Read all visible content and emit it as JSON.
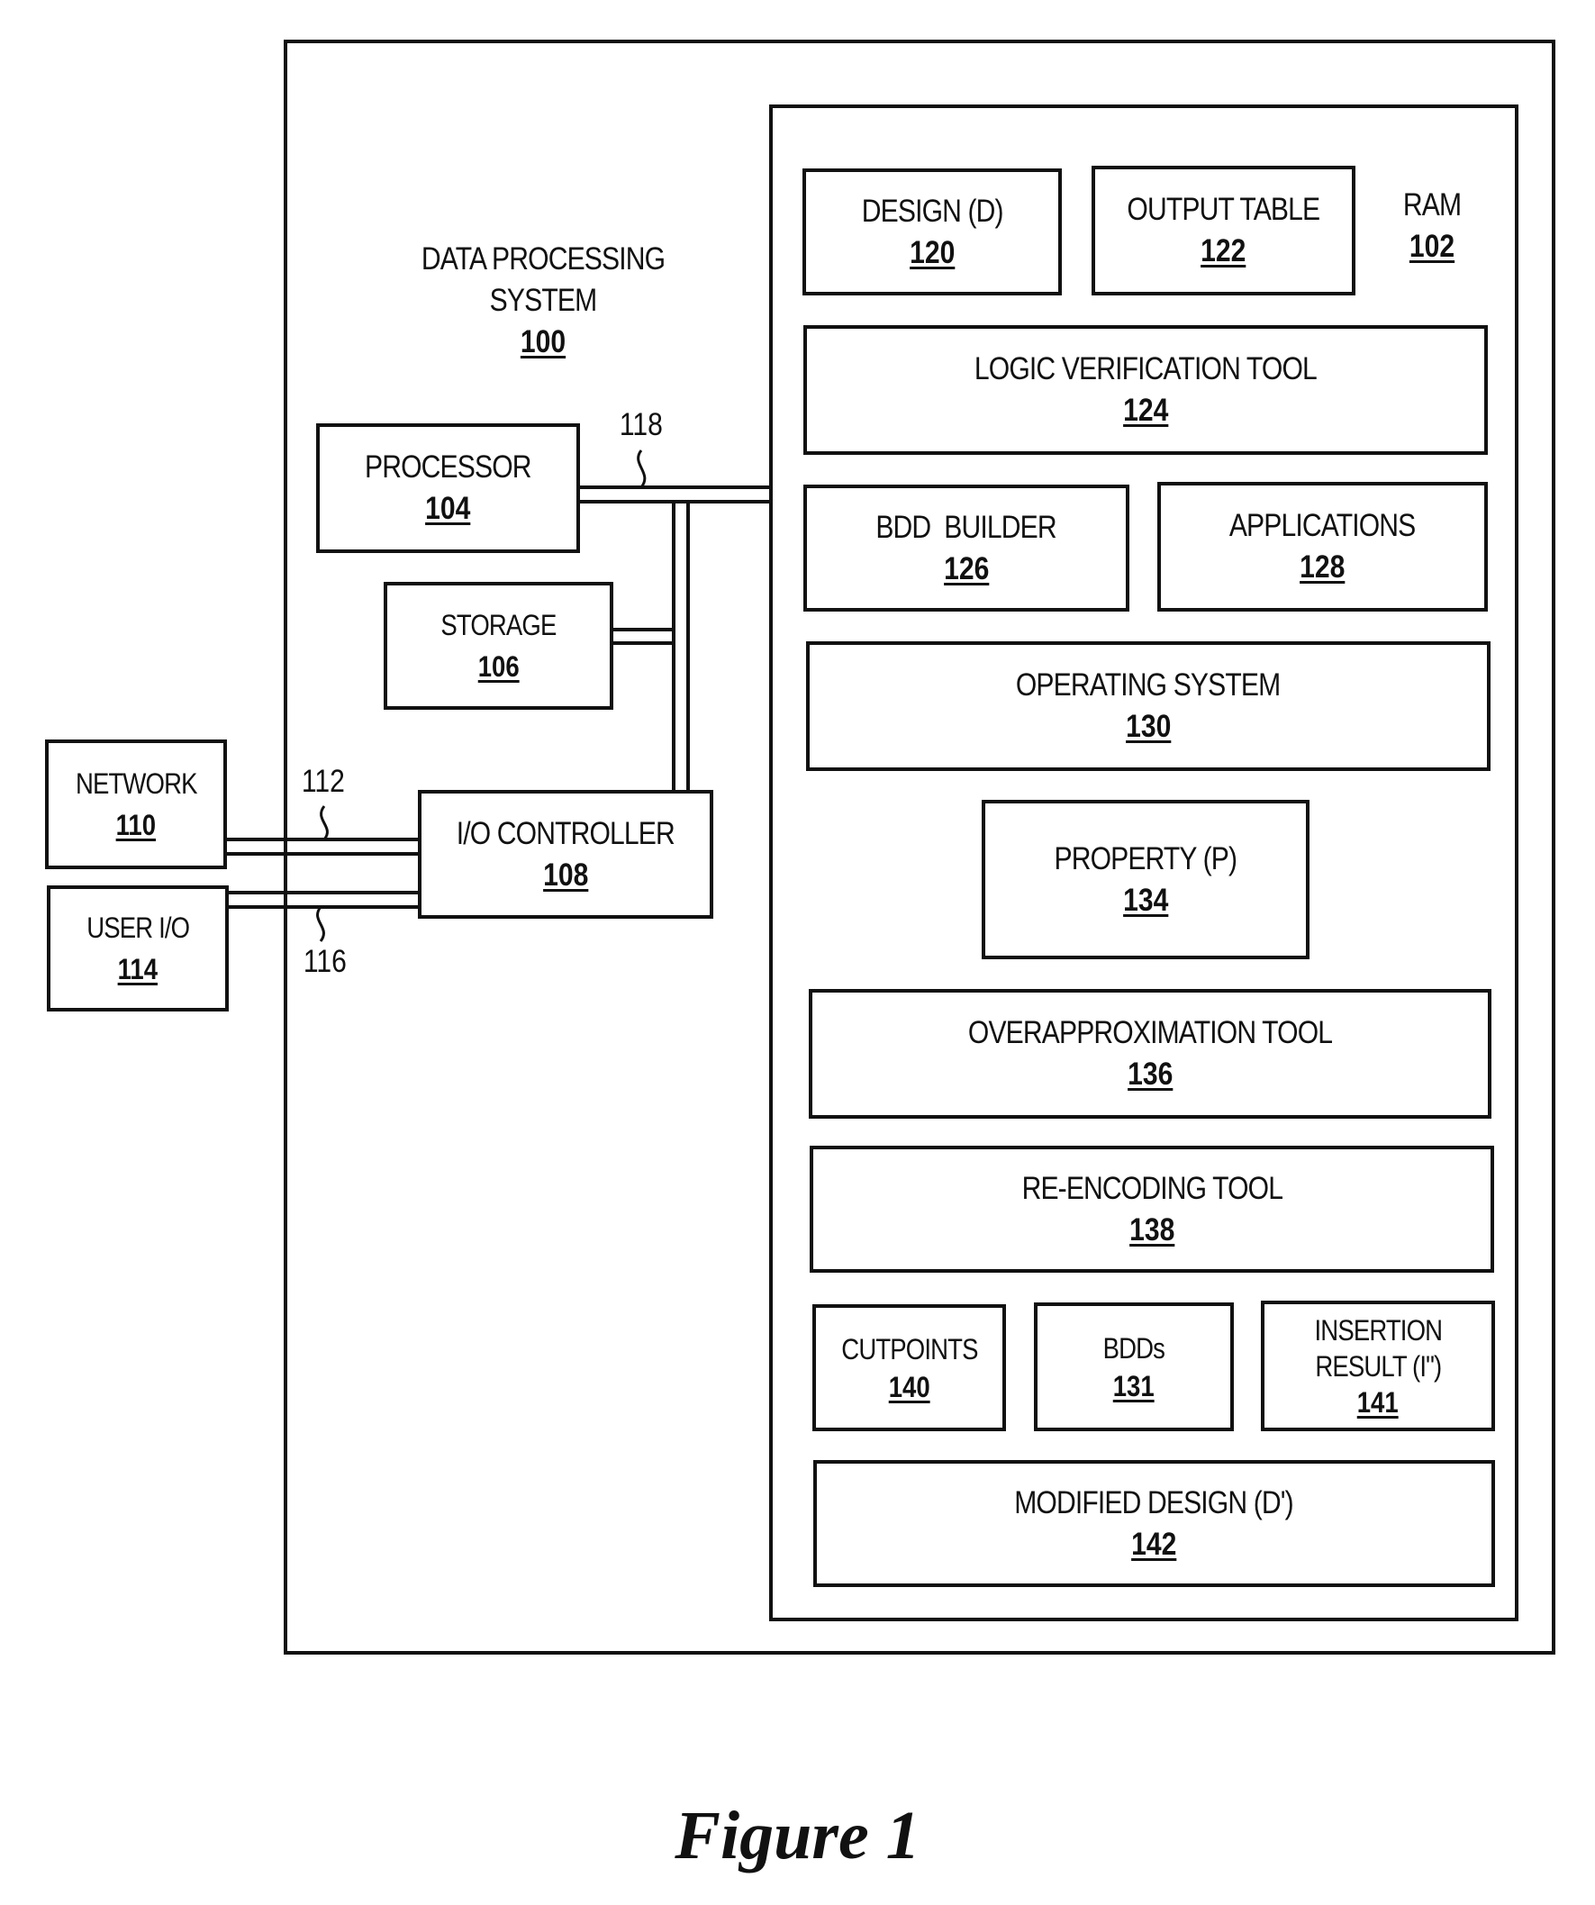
{
  "system": {
    "title_line1": "DATA PROCESSING",
    "title_line2": "SYSTEM",
    "ref": "100"
  },
  "ram": {
    "label": "RAM",
    "ref": "102"
  },
  "components": {
    "processor": {
      "label": "PROCESSOR",
      "ref": "104"
    },
    "storage": {
      "label": "STORAGE",
      "ref": "106"
    },
    "io_controller": {
      "label": "I/O CONTROLLER",
      "ref": "108"
    },
    "network": {
      "label": "NETWORK",
      "ref": "110"
    },
    "user_io": {
      "label": "USER I/O",
      "ref": "114"
    }
  },
  "connections": {
    "bus": "118",
    "network_link": "112",
    "user_io_link": "116"
  },
  "ram_contents": {
    "design": {
      "label": "DESIGN (D)",
      "ref": "120"
    },
    "output_table": {
      "label": "OUTPUT TABLE",
      "ref": "122"
    },
    "logic_verification_tool": {
      "label": "LOGIC VERIFICATION TOOL",
      "ref": "124"
    },
    "bdd_builder": {
      "label": "BDD  BUILDER",
      "ref": "126"
    },
    "applications": {
      "label": "APPLICATIONS",
      "ref": "128"
    },
    "operating_system": {
      "label": "OPERATING SYSTEM",
      "ref": "130"
    },
    "property": {
      "label": "PROPERTY (P)",
      "ref": "134"
    },
    "overapproximation_tool": {
      "label": "OVERAPPROXIMATION TOOL",
      "ref": "136"
    },
    "reencoding_tool": {
      "label": "RE-ENCODING TOOL",
      "ref": "138"
    },
    "cutpoints": {
      "label": "CUTPOINTS",
      "ref": "140"
    },
    "bdds": {
      "label": "BDDs",
      "ref": "131"
    },
    "insertion_result": {
      "label_line1": "INSERTION",
      "label_line2": "RESULT (I\")",
      "ref": "141"
    },
    "modified_design": {
      "label": "MODIFIED DESIGN (D')",
      "ref": "142"
    }
  },
  "caption": "Figure 1"
}
